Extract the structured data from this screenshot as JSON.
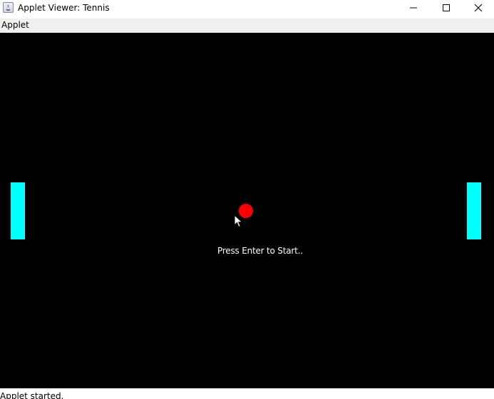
{
  "window": {
    "title": "Applet Viewer: Tennis",
    "app_icon": "java-icon"
  },
  "title_buttons": {
    "minimize_icon": "minimize-icon",
    "maximize_icon": "maximize-icon",
    "close_icon": "close-icon"
  },
  "menubar": {
    "items": [
      {
        "label": "Applet"
      }
    ]
  },
  "game": {
    "prompt": "Press Enter to Start..",
    "background_color": "#000000",
    "paddle_color": "#00ffff",
    "ball_color": "#ff0000"
  },
  "status": {
    "text": "Applet started."
  },
  "colors": {
    "titlebar": "#ffffff",
    "menubar": "#f0f0f0"
  }
}
